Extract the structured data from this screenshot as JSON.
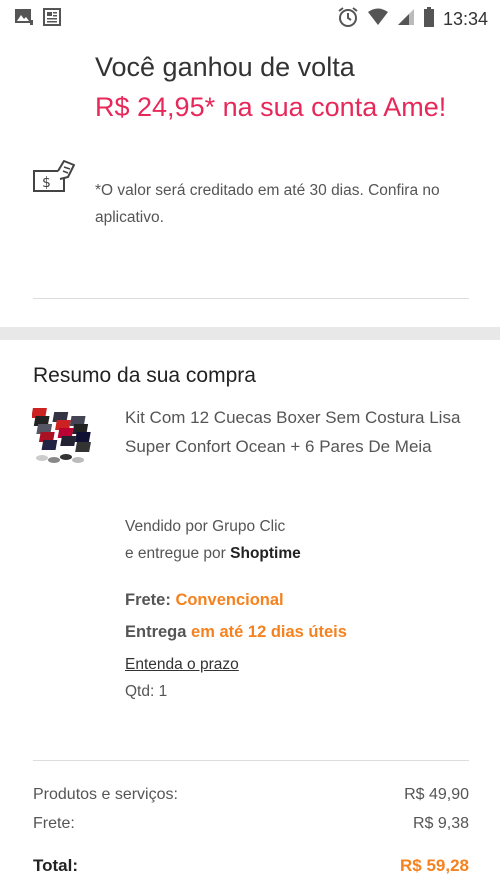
{
  "status_bar": {
    "time": "13:34",
    "left_icons": [
      "gallery-notification-icon",
      "news-notification-icon"
    ],
    "right_icons": [
      "alarm-icon",
      "wifi-icon",
      "cell-signal-icon",
      "battery-icon"
    ]
  },
  "cashback": {
    "title": "Você ganhou de volta",
    "amount_line": "R$ 24,95* na sua conta Ame!",
    "note": "*O valor será creditado em até 30 dias. Confira no aplicativo.",
    "icon": "hand-money-icon",
    "accent_color": "#e6285a"
  },
  "summary": {
    "title": "Resumo da sua compra",
    "product": {
      "name": "Kit Com 12 Cuecas Boxer Sem Costura Lisa Super Confort Ocean + 6 Pares De Meia",
      "sold_by_prefix": "Vendido por",
      "seller": "Grupo Clic",
      "delivered_by_prefix": "e entregue por",
      "deliverer": "Shoptime",
      "frete_label": "Frete:",
      "frete_value": "Convencional",
      "entrega_label": "Entrega",
      "entrega_value": "em até 12 dias úteis",
      "prazo_link": "Entenda o prazo",
      "quantity": "Qtd: 1"
    }
  },
  "totals": {
    "products_label": "Produtos e serviços:",
    "products_value": "R$ 49,90",
    "shipping_label": "Frete:",
    "shipping_value": "R$ 9,38",
    "total_label": "Total:",
    "total_value": "R$ 59,28",
    "highlight_color": "#f5821f"
  }
}
